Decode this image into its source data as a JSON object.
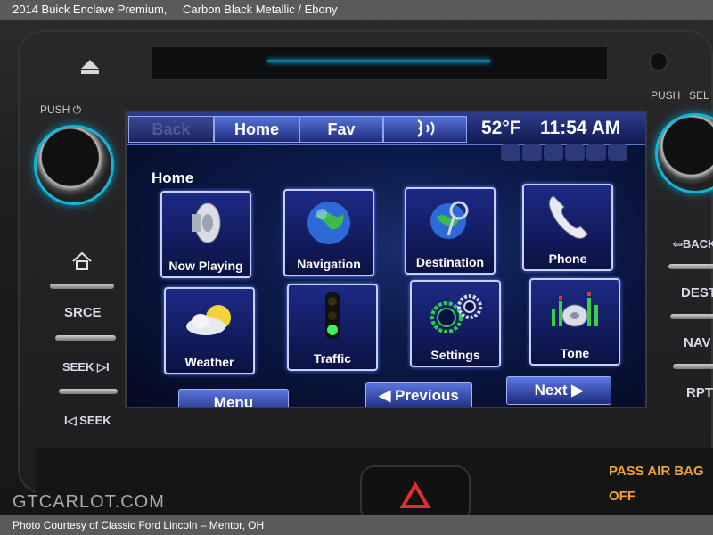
{
  "header": {
    "title": "2014 Buick Enclave Premium,",
    "subtitle": "Carbon Black Metallic / Ebony"
  },
  "footer": {
    "credit": "Photo Courtesy of Classic Ford Lincoln – Mentor, OH"
  },
  "watermark": "GTCARLOT.COM",
  "hardware": {
    "push_left": "PUSH",
    "push_right": "PUSH",
    "sel": "SEL",
    "left_buttons": [
      "SRCE",
      "SEEK ▷I",
      "I◁ SEEK"
    ],
    "right_buttons": [
      "⇦BACK",
      "DEST",
      "NAV",
      "RPT"
    ],
    "pass_air_bag": "PASS AIR BAG",
    "off": "OFF"
  },
  "screen": {
    "nav": {
      "back": "Back",
      "home": "Home",
      "fav": "Fav"
    },
    "temperature": "52°F",
    "time": "11:54 AM",
    "page_title": "Home",
    "tiles": [
      {
        "label": "Now Playing",
        "icon": "speaker-icon"
      },
      {
        "label": "Navigation",
        "icon": "globe-icon"
      },
      {
        "label": "Destination",
        "icon": "destination-icon"
      },
      {
        "label": "Phone",
        "icon": "phone-icon"
      },
      {
        "label": "Weather",
        "icon": "weather-icon"
      },
      {
        "label": "Traffic",
        "icon": "traffic-light-icon"
      },
      {
        "label": "Settings",
        "icon": "gears-icon"
      },
      {
        "label": "Tone",
        "icon": "equalizer-icon"
      }
    ],
    "menu": "Menu",
    "previous": "Previous",
    "next": "Next"
  },
  "colors": {
    "accent": "#15b5d8",
    "screen_blue": "#1c2a86",
    "amber": "#f0a22e"
  }
}
